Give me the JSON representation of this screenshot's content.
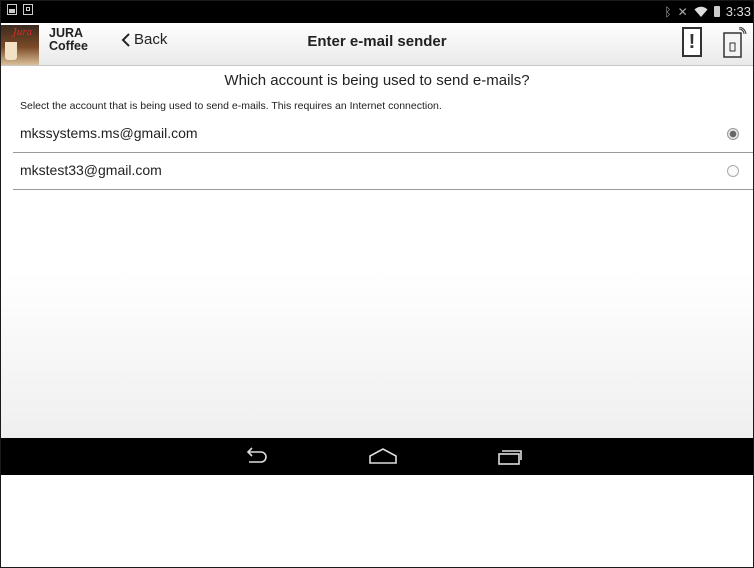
{
  "status_bar": {
    "left_icons": [
      "image-icon",
      "clipboard-icon"
    ],
    "right_icons": [
      "bluetooth-icon",
      "mute-icon",
      "wifi-icon",
      "battery-icon"
    ],
    "clock": "3:33"
  },
  "header": {
    "brand_line1": "JURA",
    "brand_line2": "Coffee",
    "back_label": "Back",
    "title": "Enter e-mail sender",
    "alert_label": "!"
  },
  "main": {
    "question": "Which account is being used to send e-mails?",
    "hint": "Select the account that is being used to send e-mails. This requires an Internet connection.",
    "accounts": [
      {
        "email": "mkssystems.ms@gmail.com",
        "selected": true
      },
      {
        "email": "mkstest33@gmail.com",
        "selected": false
      }
    ]
  },
  "nav_bar": {
    "buttons": [
      "back-nav-icon",
      "home-nav-icon",
      "recents-nav-icon"
    ]
  },
  "colors": {
    "status_bar_bg": "#000000",
    "nav_bar_bg": "#000000",
    "logo_red": "#e03030"
  }
}
